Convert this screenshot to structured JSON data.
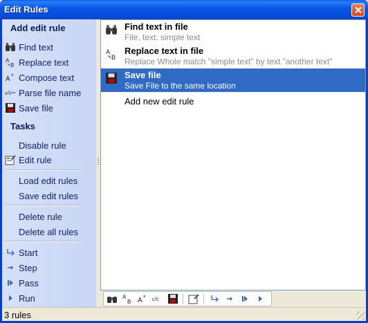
{
  "window": {
    "title": "Edit Rules"
  },
  "sidebar": {
    "add_title": "Add edit rule",
    "add_items": [
      {
        "label": "Find text",
        "icon": "binoculars-icon",
        "glyph": "🔍"
      },
      {
        "label": "Replace text",
        "icon": "replace-icon",
        "glyph": "A→B"
      },
      {
        "label": "Compose text",
        "icon": "compose-icon",
        "glyph": "A*"
      },
      {
        "label": "Parse file name",
        "icon": "parse-icon",
        "glyph": "c/v"
      },
      {
        "label": "Save file",
        "icon": "floppy-disk-icon",
        "glyph": "💾"
      }
    ],
    "tasks_title": "Tasks",
    "task_items": [
      {
        "label": "Disable rule"
      },
      {
        "label": "Edit rule",
        "icon": "edit-rule-icon",
        "glyph": "✎"
      },
      {
        "label": "Load edit rules"
      },
      {
        "label": "Save edit rules"
      },
      {
        "label": "Delete rule"
      },
      {
        "label": "Delete all rules"
      },
      {
        "label": "Start",
        "icon": "start-arrow-icon",
        "glyph": "↪"
      },
      {
        "label": "Step",
        "icon": "step-arrow-icon",
        "glyph": "➔"
      },
      {
        "label": "Pass",
        "icon": "pass-icon",
        "glyph": "⏭"
      },
      {
        "label": "Run",
        "icon": "run-icon",
        "glyph": "▶"
      }
    ]
  },
  "rules": [
    {
      "title": "Find text in file",
      "description": "File, text: simple text",
      "icon": "binoculars-icon",
      "glyph": "🔍",
      "selected": false
    },
    {
      "title": "Replace text in file",
      "description": "Replace Whole match \"simple text\" by text \"another text\"",
      "icon": "replace-icon",
      "glyph": "A→B",
      "selected": false
    },
    {
      "title": "Save file",
      "description": "Save File to the same location",
      "icon": "floppy-disk-icon",
      "glyph": "💾",
      "selected": true
    }
  ],
  "add_rule_label": "Add new edit rule",
  "status": {
    "text": "3 rules"
  },
  "colors": {
    "selection": "#316ac5",
    "sidebar": "#c8d6f4",
    "titlebar": "#0552e0"
  }
}
